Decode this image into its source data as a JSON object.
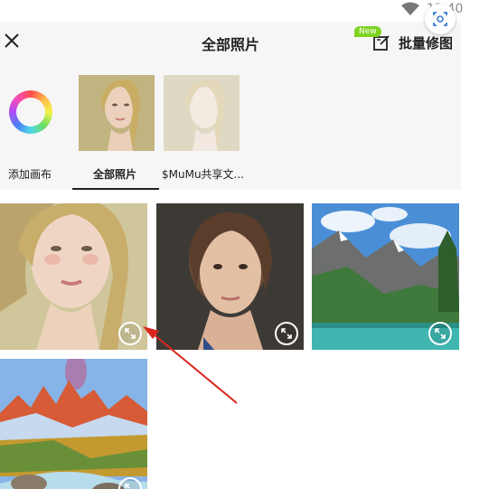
{
  "status_bar": {
    "time": "11:40",
    "wifi_icon": "wifi-icon"
  },
  "header": {
    "close_icon": "close-icon",
    "title": "全部照片",
    "batch_edit_label": "批量修图",
    "batch_edit_icon": "edit-batch-icon",
    "new_badge": "New"
  },
  "albums": [
    {
      "label": "添加画布",
      "icon": "color-wheel-icon"
    },
    {
      "label": "全部照片",
      "selected": true
    },
    {
      "label": "$MuMu共享文..."
    }
  ],
  "photos": [
    {
      "subject": "blonde woman portrait",
      "expand_icon": "expand-icon"
    },
    {
      "subject": "woman portrait dark background",
      "expand_icon": "expand-icon"
    },
    {
      "subject": "mountain lake landscape",
      "expand_icon": "expand-icon"
    },
    {
      "subject": "mountain river landscape",
      "expand_icon": "expand-icon"
    }
  ],
  "colors": {
    "accent_badge": "#7ed321",
    "annotation_arrow": "#d9261c",
    "header_bg": "#f6f6f6"
  }
}
